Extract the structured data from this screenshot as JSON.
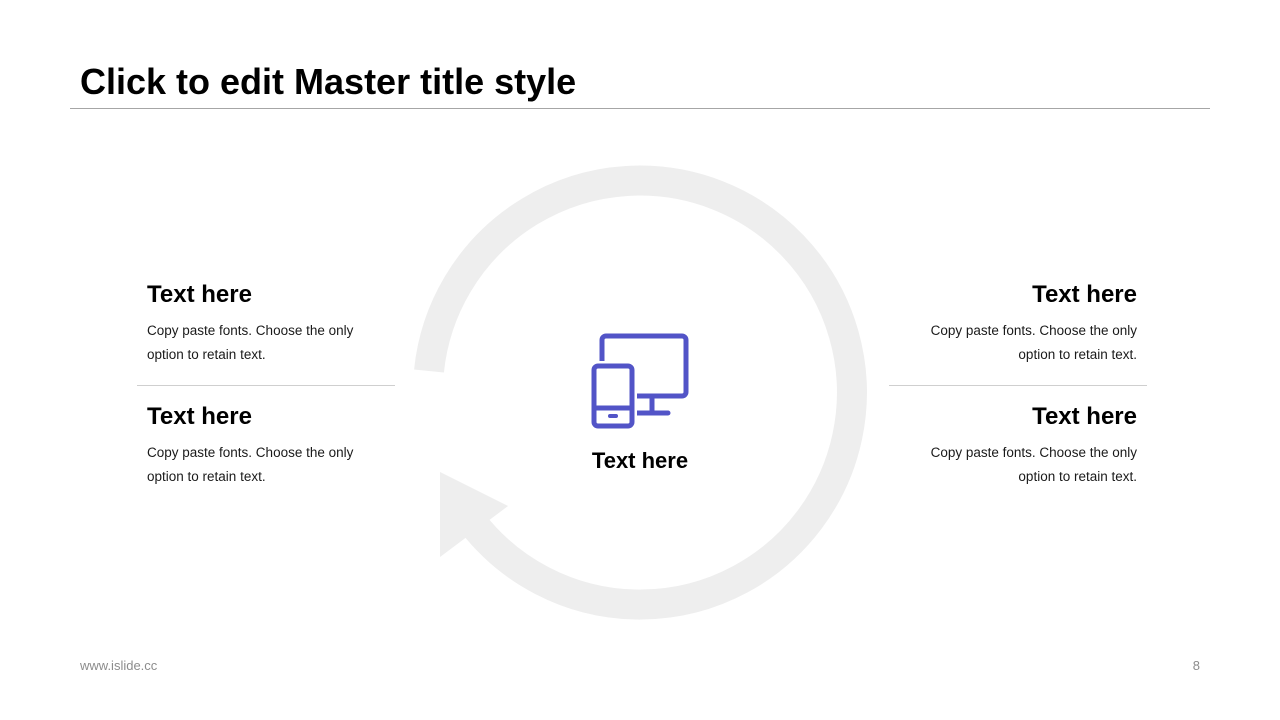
{
  "title": "Click to edit Master title style",
  "center": {
    "label": "Text here",
    "icon": "devices-icon"
  },
  "blocks": {
    "top_left": {
      "heading": "Text here",
      "body": "Copy paste fonts. Choose the only option to retain text."
    },
    "bottom_left": {
      "heading": "Text here",
      "body": "Copy paste fonts. Choose the only option to retain text."
    },
    "top_right": {
      "heading": "Text here",
      "body": "Copy paste fonts. Choose the only option to retain text."
    },
    "bottom_right": {
      "heading": "Text here",
      "body": "Copy paste fonts. Choose the only option to retain text."
    }
  },
  "footer": {
    "website": "www.islide.cc",
    "page_number": "8"
  },
  "colors": {
    "accent": "#5254c7",
    "cycle": "#eeeeee",
    "rule": "#a6a6a6"
  }
}
